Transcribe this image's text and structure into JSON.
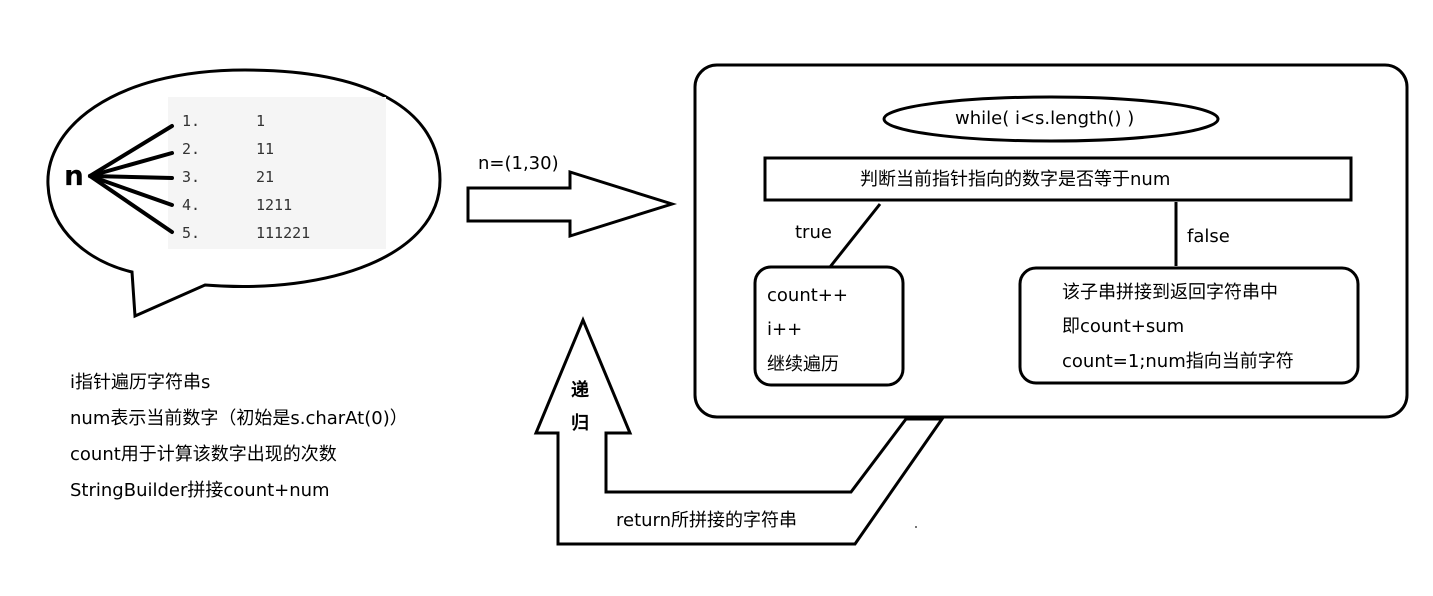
{
  "bubble": {
    "label": "n",
    "rows": [
      {
        "index": "1.",
        "value": "1"
      },
      {
        "index": "2.",
        "value": "11"
      },
      {
        "index": "3.",
        "value": "21"
      },
      {
        "index": "4.",
        "value": "1211"
      },
      {
        "index": "5.",
        "value": "111221"
      }
    ]
  },
  "notes": [
    "i指针遍历字符串s",
    "num表示当前数字（初始是s.charAt(0)）",
    "count用于计算该数字出现的次数",
    "StringBuilder拼接count+num"
  ],
  "arrow_label": "n=(1,30)",
  "loop": {
    "condition": "while( i<s.length() )",
    "decision": "判断当前指针指向的数字是否等于num",
    "true_label": "true",
    "false_label": "false",
    "true_lines": [
      "count++",
      "i++",
      "继续遍历"
    ],
    "false_lines": [
      "该子串拼接到返回字符串中",
      "即count+sum",
      "count=1;num指向当前字符"
    ]
  },
  "recursion": {
    "label_top": "递",
    "label_bottom": "归",
    "return_label": "return所拼接的字符串"
  }
}
